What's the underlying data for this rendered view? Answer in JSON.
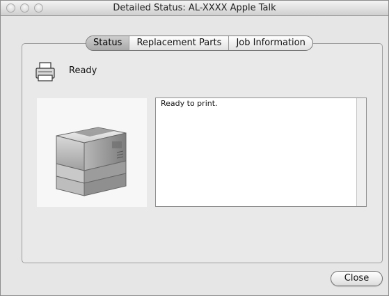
{
  "window": {
    "title": "Detailed Status: AL-XXXX  Apple Talk"
  },
  "tabs": [
    {
      "label": "Status",
      "active": true
    },
    {
      "label": "Replacement Parts",
      "active": false
    },
    {
      "label": "Job Information",
      "active": false
    }
  ],
  "status": {
    "label": "Ready",
    "icon": "printer-icon"
  },
  "printer_image": {
    "icon": "laser-printer-illustration"
  },
  "message": {
    "text": "Ready to print."
  },
  "buttons": {
    "close_label": "Close"
  },
  "colors": {
    "window_bg": "#e6e6e6",
    "active_tab": "#b8b8b8",
    "message_bg": "#ffffff"
  }
}
